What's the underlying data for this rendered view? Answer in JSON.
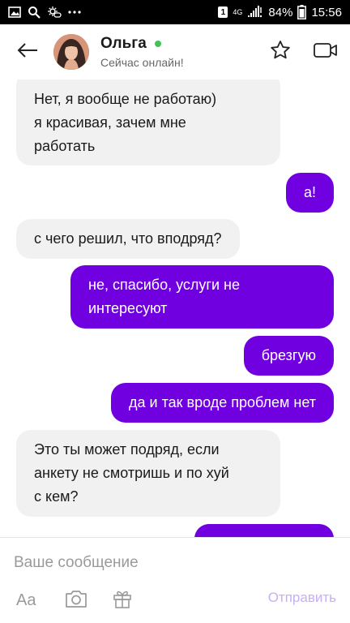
{
  "status_bar": {
    "sim_label": "1",
    "network": "4G",
    "battery": "84%",
    "time": "15:56"
  },
  "header": {
    "contact_name": "Ольга",
    "contact_status": "Сейчас онлайн!"
  },
  "messages": [
    {
      "dir": "in",
      "text": "Нет, я вообще не работаю)\nя красивая, зачем мне\nработать"
    },
    {
      "dir": "out",
      "text": "а!"
    },
    {
      "dir": "in",
      "text": "с чего решил, что вподряд?"
    },
    {
      "dir": "out",
      "text": "не, спасибо, услуги не\nинтересуют"
    },
    {
      "dir": "out",
      "text": "брезгую"
    },
    {
      "dir": "out",
      "text": "да и так вроде проблем нет"
    },
    {
      "dir": "in",
      "text": "Это ты может подряд, если\nанкету не смотришь и по хуй\nс кем?"
    },
    {
      "dir": "out",
      "text": ""
    }
  ],
  "composer": {
    "placeholder": "Ваше сообщение",
    "font_tool_label": "Aa",
    "send_label": "Отправить"
  },
  "colors": {
    "accent": "#7000e0",
    "incoming_bubble": "#f1f1f2",
    "online": "#42c35a",
    "send_disabled": "#c9aef4"
  },
  "icons": [
    "gallery-icon",
    "search-icon",
    "weather-icon",
    "more-dots-icon",
    "signal-icon",
    "battery-icon",
    "back-arrow-icon",
    "star-icon",
    "video-call-icon",
    "camera-icon",
    "gift-icon"
  ]
}
